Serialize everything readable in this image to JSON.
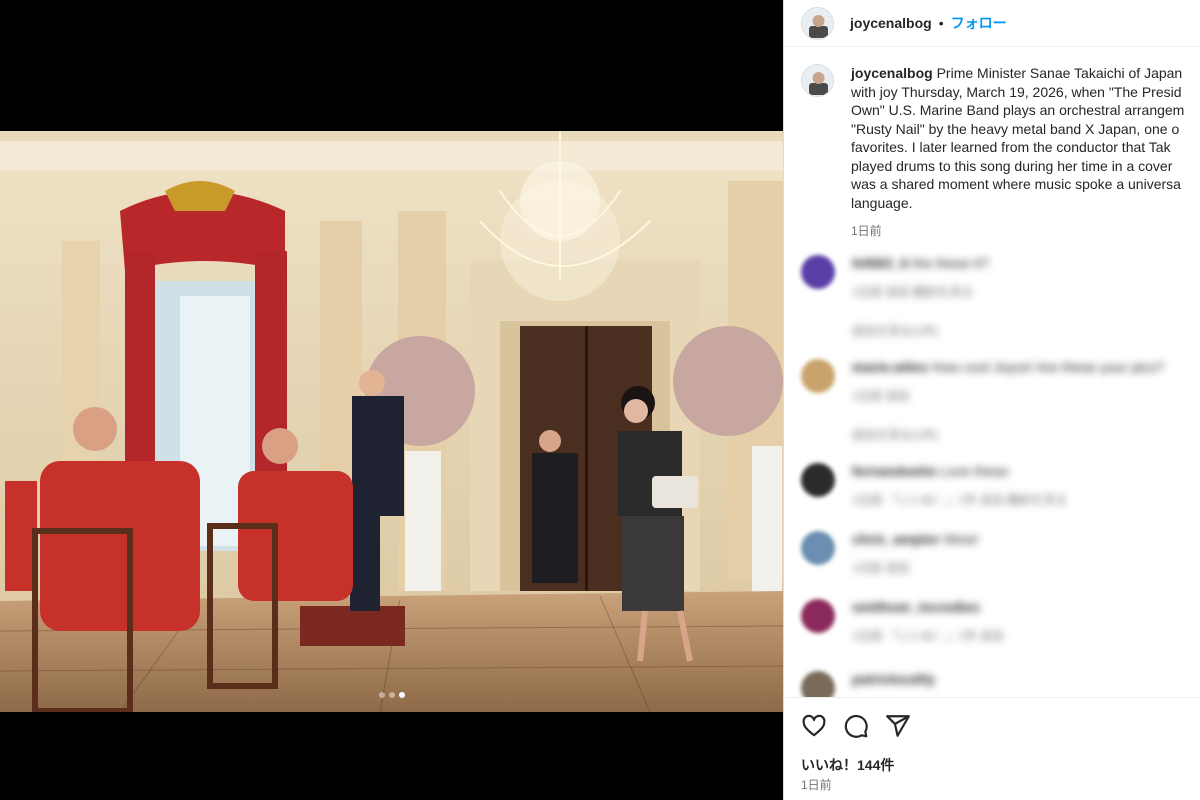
{
  "post": {
    "username": "joycenalbog",
    "separator": "•",
    "follow_label": "フォロー",
    "caption": "Prime Minister Sanae Takaichi of Japan\nwith joy Thursday, March 19, 2026, when \"The Presid\nOwn\" U.S. Marine Band plays an orchestral arrangem\n\"Rusty Nail\" by the heavy metal band X Japan, one o\nfavorites. I later learned from the conductor that Tak\nplayed drums to this song during her time in a cover\nwas a shared moment where music spoke a universa\nlanguage.",
    "caption_time": "1日前",
    "likes": "いいね！144件",
    "time": "1日前",
    "carousel": {
      "count": 3,
      "active_index": 2
    }
  },
  "comments": [
    {
      "user": "tt4563_ti",
      "text": "the these it?",
      "meta": "1日前   返信   翻訳を見る",
      "replies": "返信を見る(1件)",
      "avatar_color": "#5a3fa8"
    },
    {
      "user": "marie.wiles",
      "text": "How cool Joyce! Are these your pics?",
      "meta": "1日前   返信",
      "replies": "返信を見る(1件)",
      "avatar_color": "#c9a46a"
    },
    {
      "user": "fernandoelm",
      "text": "Love these",
      "meta": "1日前   「いいね！」1件   返信   翻訳を見る",
      "replies": "",
      "avatar_color": "#2b2b2b"
    },
    {
      "user": "chris_amplor",
      "text": "Wow!",
      "meta": "1日前   返信",
      "replies": "",
      "avatar_color": "#6a8fb0"
    },
    {
      "user": "smithum_incredies",
      "text": "",
      "meta": "1日前   「いいね！」1件   返信",
      "replies": "",
      "avatar_color": "#8a2a5a"
    },
    {
      "user": "patricksuttly",
      "text": "",
      "meta": "",
      "replies": "",
      "avatar_color": "#7a6a5a"
    }
  ],
  "colors": {
    "accent": "#0095f6",
    "muted": "#737373",
    "text": "#262626"
  },
  "icons": [
    "heart-icon",
    "comment-icon",
    "share-icon"
  ]
}
